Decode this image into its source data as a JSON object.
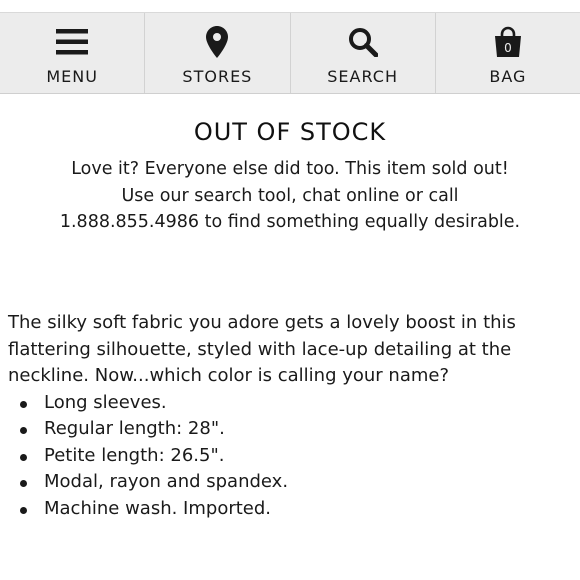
{
  "nav": {
    "items": [
      {
        "label": "MENU",
        "icon": "menu-icon"
      },
      {
        "label": "STORES",
        "icon": "map-pin-icon"
      },
      {
        "label": "SEARCH",
        "icon": "search-icon"
      },
      {
        "label": "BAG",
        "icon": "bag-icon"
      }
    ],
    "bag_count": "0"
  },
  "notice": {
    "title": "OUT OF STOCK",
    "message": "Love it? Everyone else did too. This item sold out! Use our search tool, chat online or call 1.888.855.4986 to find something equally desirable."
  },
  "product": {
    "description": "The silky soft fabric you adore gets a lovely boost in this flattering silhouette, styled with lace-up detailing at the neckline. Now...which color is calling your name?",
    "features": [
      "Long sleeves.",
      "Regular length: 28\".",
      "Petite length: 26.5\".",
      "Modal, rayon and spandex.",
      "Machine wash. Imported."
    ]
  },
  "colors": {
    "nav_bg": "#ececec",
    "text": "#1a1a1a"
  }
}
